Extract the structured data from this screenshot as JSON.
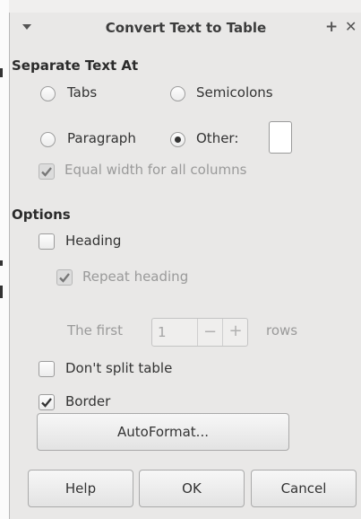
{
  "dialog": {
    "title": "Convert Text to Table",
    "menu_icon": "triangle-down-icon",
    "pin_icon": "plus-icon",
    "close_icon": "close-icon",
    "close_glyph": "✕",
    "pin_glyph": "+"
  },
  "separate": {
    "heading": "Separate Text At",
    "tabs_label": "Tabs",
    "semicolons_label": "Semicolons",
    "paragraph_label": "Paragraph",
    "other_label": "Other:",
    "other_value": "",
    "selected": "Other",
    "equal_width_label": "Equal width for all columns",
    "equal_width_checked": true
  },
  "options": {
    "heading": "Options",
    "heading_label": "Heading",
    "heading_checked": false,
    "repeat_heading_label": "Repeat heading",
    "repeat_heading_checked": true,
    "first_label": "The first",
    "rows_value": "1",
    "minus_glyph": "−",
    "plus_glyph": "+",
    "rows_label": "rows",
    "dont_split_label": "Don't split table",
    "dont_split_checked": false,
    "border_label": "Border",
    "border_checked": true
  },
  "buttons": {
    "autoformat": "AutoFormat...",
    "help": "Help",
    "ok": "OK",
    "cancel": "Cancel"
  }
}
